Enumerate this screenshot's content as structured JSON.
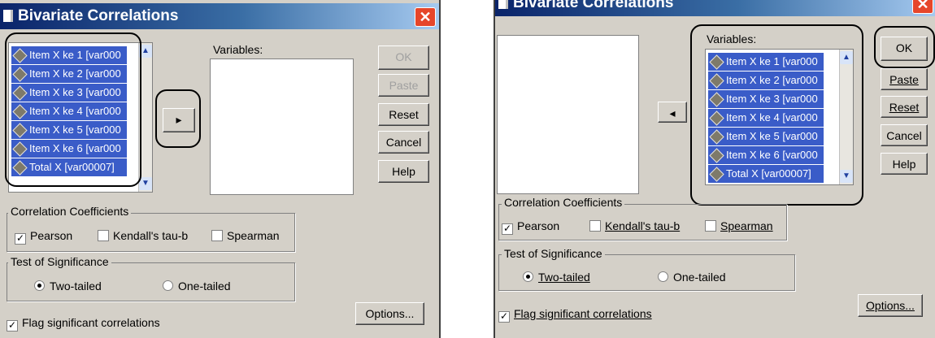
{
  "dialog_title": "Bivariate Correlations",
  "close_glyph": "✕",
  "variables_label": "Variables:",
  "source_items": [
    "Item X ke 1 [var000",
    "Item X ke 2 [var000",
    "Item X ke 3 [var000",
    "Item X ke 4 [var000",
    "Item X ke 5 [var000",
    "Item X ke 6 [var000",
    "Total X [var00007]"
  ],
  "buttons": {
    "ok": "OK",
    "paste": "Paste",
    "reset": "Reset",
    "cancel": "Cancel",
    "help": "Help",
    "options": "Options..."
  },
  "move_right_glyph": "▸",
  "move_left_glyph": "◂",
  "scroll_up_glyph": "▲",
  "scroll_down_glyph": "▼",
  "correlation_coefficients": {
    "title": "Correlation Coefficients",
    "pearson": "Pearson",
    "kendall": "Kendall's tau-b",
    "spearman": "Spearman",
    "pearson_checked": true,
    "kendall_checked": false,
    "spearman_checked": false
  },
  "test_of_significance": {
    "title": "Test of Significance",
    "two_tailed": "Two-tailed",
    "one_tailed": "One-tailed",
    "selected": "two_tailed"
  },
  "flag_significant": "Flag significant correlations",
  "check_glyph": "✓",
  "icons": [
    "var-scale-icon",
    "arrow-right-icon",
    "arrow-left-icon",
    "close-icon"
  ]
}
